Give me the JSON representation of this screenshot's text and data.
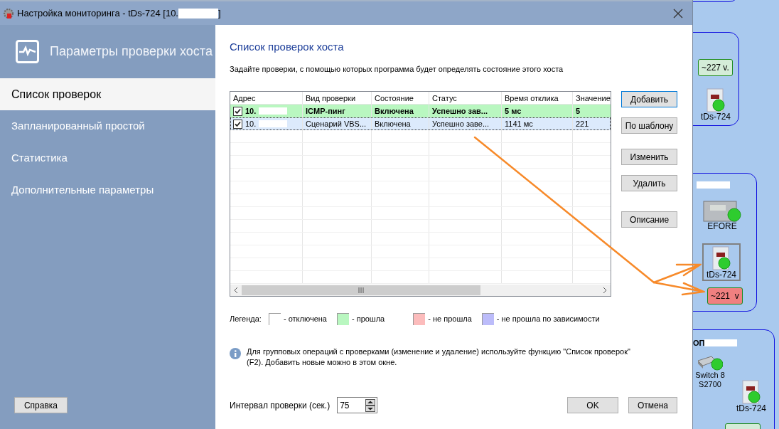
{
  "window": {
    "title": "Настройка мониторинга - tDs-724 [10.",
    "title_end": "]"
  },
  "sidebar": {
    "title": "Параметры проверки хоста",
    "items": [
      {
        "label": "Список проверок",
        "selected": true
      },
      {
        "label": "Запланированный простой",
        "selected": false
      },
      {
        "label": "Статистика",
        "selected": false
      },
      {
        "label": "Дополнительные параметры",
        "selected": false
      }
    ],
    "help_button": "Справка"
  },
  "content": {
    "title": "Список проверок хоста",
    "description": "Задайте проверки, с помощью которых программа будет определять состояние этого хоста"
  },
  "table": {
    "columns": [
      "Адрес",
      "Вид проверки",
      "Состояние",
      "Статус",
      "Время отклика",
      "Значение"
    ],
    "rows": [
      {
        "checked": true,
        "selected": false,
        "bold": true,
        "color": "#b9f7c0",
        "cells": [
          "10.",
          "ICMP-пинг",
          "Включена",
          "Успешно зав...",
          "5 мс",
          "5"
        ]
      },
      {
        "checked": true,
        "selected": true,
        "bold": false,
        "cells": [
          "10.",
          "Сценарий VBS...",
          "Включена",
          "Успешно заве...",
          "1141 мс",
          "221"
        ]
      }
    ]
  },
  "buttons": [
    "Добавить",
    "По шаблону",
    "Изменить",
    "Удалить",
    "Описание"
  ],
  "legend": {
    "label": "Легенда:",
    "items": [
      {
        "color": "#ffffff",
        "text": "- отключена"
      },
      {
        "color": "#b9f7c0",
        "text": "- прошла"
      },
      {
        "color": "#fcbcbc",
        "text": "- не прошла"
      },
      {
        "color": "#bcbcfa",
        "text": "- не прошла по зависимости"
      }
    ]
  },
  "info": "Для групповых операций с проверками (изменение и удаление) используйте функцию \"Список проверок\" (F2). Добавить новые можно в этом окне.",
  "interval": {
    "label": "Интервал проверки (сек.)",
    "value": "75"
  },
  "dialog_buttons": [
    "OK",
    "Отмена"
  ],
  "map": {
    "nodes": [
      {
        "kind": "value",
        "text": "~227 v.",
        "color": "#d4ecd8"
      },
      {
        "kind": "device",
        "text": "tDs-724",
        "selected": false
      },
      {
        "kind": "meter",
        "text": "EFORE",
        "selected": false
      },
      {
        "kind": "device",
        "text": "tDs-724",
        "selected": true
      },
      {
        "kind": "value",
        "text": "~221  v",
        "color": "#f08080"
      },
      {
        "kind": "group",
        "text": "ОП"
      },
      {
        "kind": "switch",
        "text": "Switch 8 S2700",
        "selected": false
      },
      {
        "kind": "device",
        "text": "tDs-724",
        "selected": false
      }
    ]
  }
}
